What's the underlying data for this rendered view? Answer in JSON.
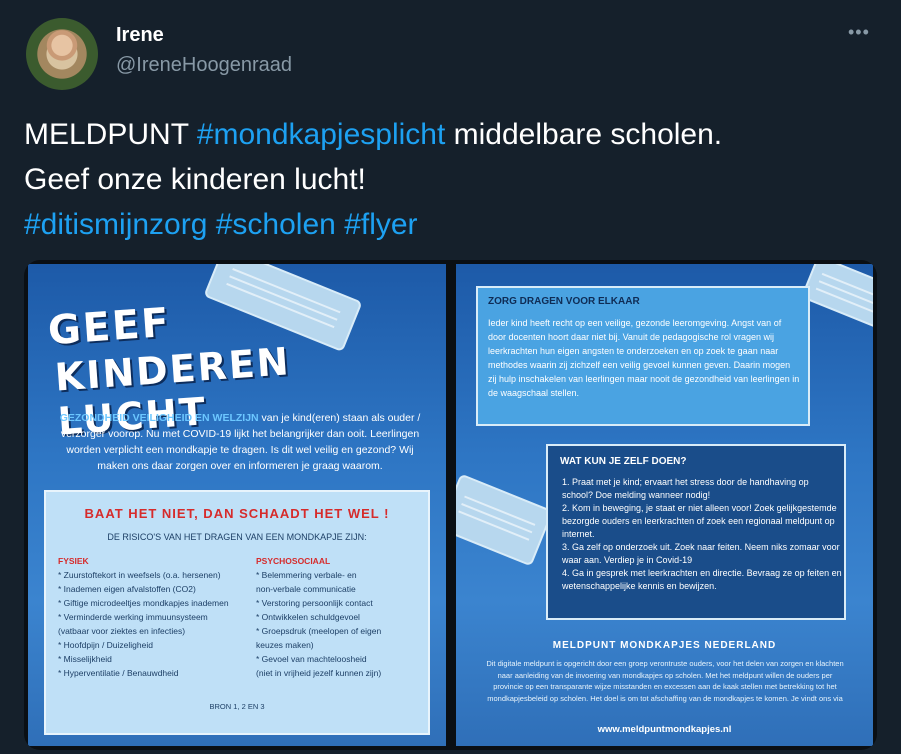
{
  "user": {
    "name": "Irene",
    "handle": "@IreneHoogenraad"
  },
  "more_icon": "•••",
  "tweet": {
    "line1_prefix": "MELDPUNT ",
    "hashtag1": "#mondkapjesplicht",
    "line1_suffix": " middelbare scholen.",
    "line2": "Geef onze kinderen lucht!",
    "hashtag2": "#ditismijnzorg",
    "hashtag3": "#scholen",
    "hashtag4": "#flyer"
  },
  "flyer_left": {
    "title_line1": "GEEF",
    "title_line2": "KINDEREN LUCHT",
    "intro_highlight": "GEZONDHEID VEILIGHEID EN WELZIJN",
    "intro_text": " van je kind(eren) staan als ouder / verzorger voorop. Nu met COVID-19 lijkt het belangrijker dan ooit. Leerlingen worden verplicht een mondkapje te dragen. Is dit wel veilig en gezond? Wij maken ons daar zorgen over en informeren je graag waarom.",
    "risk_title": "BAAT HET NIET, DAN SCHAADT HET WEL !",
    "risk_subtitle": "DE RISICO'S VAN HET DRAGEN VAN EEN MONDKAPJE ZIJN:",
    "col1_head": "FYSIEK",
    "col1_items": [
      "* Zuurstoftekort in weefsels (o.a. hersenen)",
      "* Inademen eigen afvalstoffen (CO2)",
      "* Giftige microdeeltjes mondkapjes inademen",
      "* Verminderde werking immuunsysteem",
      "(vatbaar voor ziektes en infecties)",
      "* Hoofdpijn / Duizeligheid",
      "* Misselijkheid",
      "* Hyperventilatie / Benauwdheid"
    ],
    "col2_head": "PSYCHOSOCIAAL",
    "col2_items": [
      "* Belemmering verbale- en",
      "non-verbale communicatie",
      "* Verstoring persoonlijk contact",
      "* Ontwikkelen schuldgevoel",
      "* Groepsdruk (meelopen of eigen",
      "keuzes maken)",
      "* Gevoel van machteloosheid",
      "(niet in vrijheid jezelf kunnen zijn)"
    ],
    "footnote": "BRON 1, 2 EN 3"
  },
  "flyer_right": {
    "care_title": "ZORG DRAGEN VOOR ELKAAR",
    "care_text": "Ieder kind heeft recht op een veilige, gezonde leeromgeving. Angst van of door docenten hoort daar niet bij. Vanuit de pedagogische rol vragen wij leerkrachten hun eigen angsten te onderzoeken en op zoek te gaan naar methodes waarin zij zichzelf een veilig gevoel kunnen geven. Daarin mogen zij hulp inschakelen van leerlingen maar nooit de gezondheid van leerlingen in de waagschaal stellen.",
    "what_title": "WAT KUN JE ZELF DOEN?",
    "what_items": [
      "1. Praat met je kind; ervaart het stress door de handhaving op school? Doe melding wanneer nodig!",
      "2. Kom in beweging, je staat er niet alleen voor! Zoek gelijkgestemde bezorgde ouders en leerkrachten of zoek een regionaal meldpunt op internet.",
      "3. Ga zelf op onderzoek uit. Zoek naar feiten. Neem niks zomaar voor waar aan. Verdiep je in Covid-19",
      "4. Ga in gesprek met leerkrachten en directie. Bevraag ze op feiten en wetenschappelijke kennis en bewijzen."
    ],
    "meld_title": "MELDPUNT MONDKAPJES NEDERLAND",
    "meld_text": "Dit digitale meldpunt is opgericht door een groep verontruste ouders, voor het delen van zorgen en klachten naar aanleiding van de invoering van mondkapjes op scholen. Met het meldpunt willen de ouders per provincie op een transparante wijze misstanden en excessen aan de kaak stellen met betrekking tot het mondkapjesbeleid op scholen. Het doel is om tot afschaffing van de mondkapjes te komen. Je vindt ons via",
    "meld_url": "www.meldpuntmondkapjes.nl"
  }
}
